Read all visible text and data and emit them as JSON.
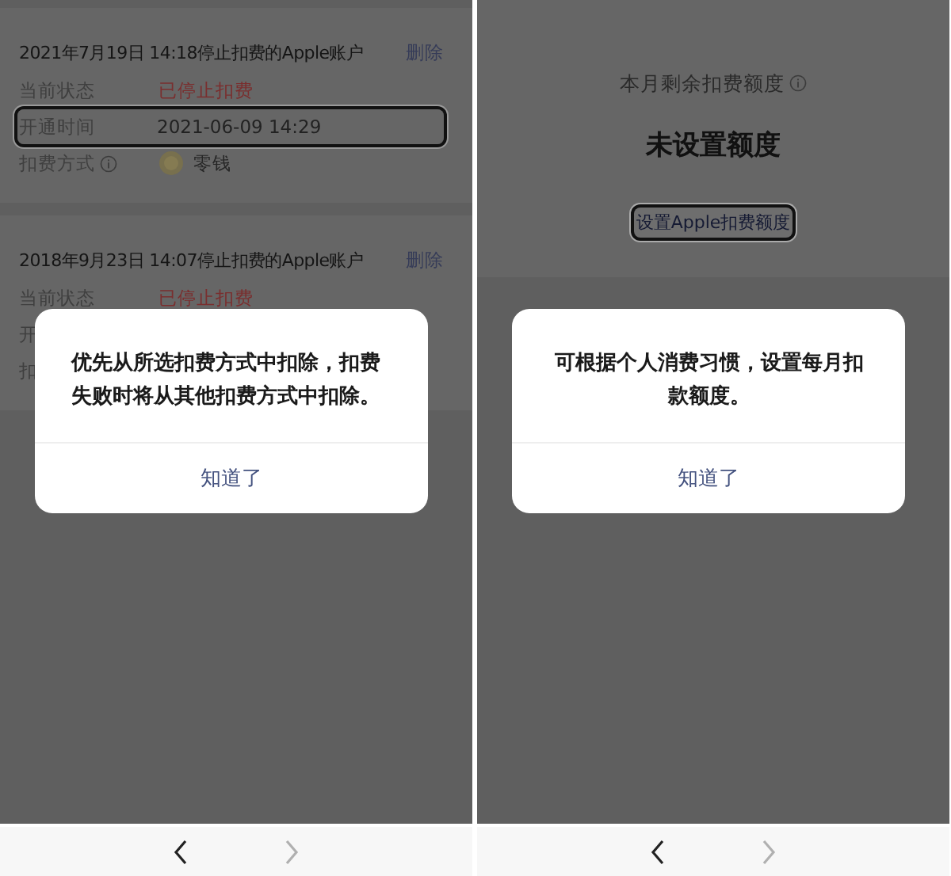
{
  "panels": [
    {
      "kind": "records",
      "records": [
        {
          "title": "2021年7月19日 14:18停止扣费的Apple账户",
          "action": "删除",
          "rows": [
            {
              "kind": "status",
              "label": "当前状态",
              "value": "已停止扣费",
              "outlined": false
            },
            {
              "kind": "text",
              "label": "开通时间",
              "value": "2021-06-09 14:29",
              "outlined": true
            },
            {
              "kind": "method",
              "label": "扣费方式",
              "info": true,
              "value": "零钱",
              "outlined": false
            }
          ]
        },
        {
          "title": "2018年9月23日 14:07停止扣费的Apple账户",
          "action": "删除",
          "rows": [
            {
              "kind": "status",
              "label": "当前状态",
              "value": "已停止扣费",
              "outlined": false
            },
            {
              "kind": "partial",
              "label": "开",
              "outlined": false
            },
            {
              "kind": "partial",
              "label": "扣",
              "outlined": false
            }
          ]
        }
      ],
      "dialog": {
        "message": "优先从所选扣费方式中扣除，扣费失败时将从其他扣费方式中扣除。",
        "button": "知道了"
      },
      "nav": {
        "back_disabled": false,
        "forward_disabled": true
      }
    },
    {
      "kind": "quota",
      "quota": {
        "label": "本月剩余扣费额度",
        "info": true,
        "value": "未设置额度",
        "button": "设置Apple扣费额度",
        "button_outlined": true
      },
      "dialog": {
        "message": "可根据个人消费习惯，设置每月扣款额度。",
        "button": "知道了"
      },
      "nav": {
        "back_disabled": false,
        "forward_disabled": true
      }
    }
  ]
}
